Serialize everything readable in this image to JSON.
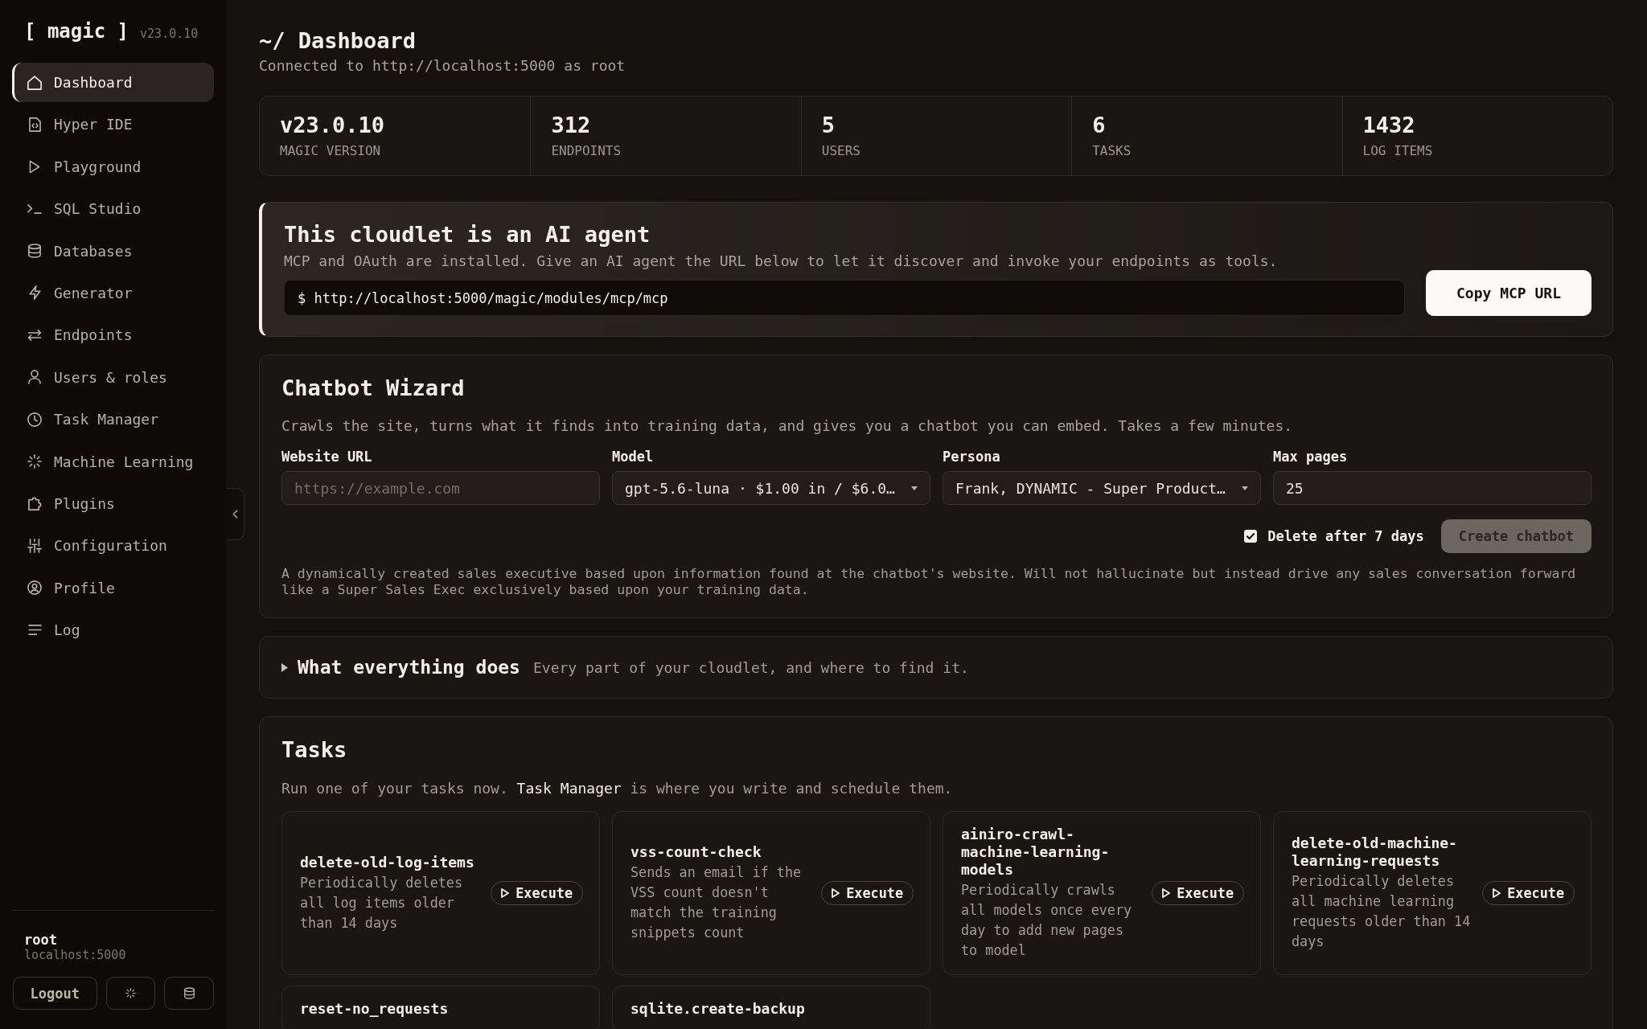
{
  "sidebar": {
    "logo": "[ magic ]",
    "version": "v23.0.10",
    "nav": [
      {
        "label": "Dashboard",
        "selected": true
      },
      {
        "label": "Hyper IDE",
        "selected": false
      },
      {
        "label": "Playground",
        "selected": false
      },
      {
        "label": "SQL Studio",
        "selected": false
      },
      {
        "label": "Databases",
        "selected": false
      },
      {
        "label": "Generator",
        "selected": false
      },
      {
        "label": "Endpoints",
        "selected": false
      },
      {
        "label": "Users & roles",
        "selected": false
      },
      {
        "label": "Task Manager",
        "selected": false
      },
      {
        "label": "Machine Learning",
        "selected": false
      },
      {
        "label": "Plugins",
        "selected": false
      },
      {
        "label": "Configuration",
        "selected": false
      },
      {
        "label": "Profile",
        "selected": false
      },
      {
        "label": "Log",
        "selected": false
      }
    ],
    "user": {
      "name": "root",
      "host": "localhost:5000"
    },
    "logout_button": "Logout"
  },
  "header": {
    "title": "~/ Dashboard",
    "subtitle": "Connected to http://localhost:5000 as root"
  },
  "stats": [
    {
      "value": "v23.0.10",
      "label": "MAGIC VERSION"
    },
    {
      "value": "312",
      "label": "ENDPOINTS"
    },
    {
      "value": "5",
      "label": "USERS"
    },
    {
      "value": "6",
      "label": "TASKS"
    },
    {
      "value": "1432",
      "label": "LOG ITEMS"
    }
  ],
  "agent_card": {
    "title": "This cloudlet is an AI agent",
    "description": "MCP and OAuth are installed. Give an AI agent the URL below to let it discover and invoke your endpoints as tools.",
    "command": "$ http://localhost:5000/magic/modules/mcp/mcp",
    "button": "Copy MCP URL"
  },
  "chatbot_wizard": {
    "title": "Chatbot Wizard",
    "description": "Crawls the site, turns what it finds into training data, and gives you a chatbot you can embed. Takes a few minutes.",
    "fields": [
      {
        "kind": "input",
        "label": "Website URL",
        "placeholder": "https://example.com"
      },
      {
        "kind": "select",
        "label": "Model",
        "value": "gpt-5.6-luna · $1.00 in / $6.0…"
      },
      {
        "kind": "select",
        "label": "Persona",
        "value": "Frank, DYNAMIC - Super Product…"
      },
      {
        "kind": "input",
        "label": "Max pages",
        "value": "25"
      }
    ],
    "delete_option": {
      "label": "Delete after 7 days",
      "checked": true
    },
    "create_button": {
      "label": "Create chatbot",
      "disabled": true
    },
    "persona_description": "A dynamically created sales executive based upon information found at the chatbot's website. Will not hallucinate but instead drive any sales conversation forward like a Super Sales Exec exclusively based upon your training data."
  },
  "help_section": {
    "title": "What everything does",
    "subtitle": "Every part of your cloudlet, and where to find it.",
    "expanded": false
  },
  "tasks": {
    "title": "Tasks",
    "description": {
      "text_before": "Run one of your tasks now.",
      "link": "Task Manager",
      "text_after": "is where you write and schedule them."
    },
    "items": [
      {
        "name": "delete-old-log-items",
        "description": "Periodically deletes all log items older than 14 days",
        "button": "Execute"
      },
      {
        "name": "vss-count-check",
        "description": "Sends an email if the VSS count doesn't match the training snippets count",
        "button": "Execute"
      },
      {
        "name": "ainiro-crawl-machine-learning-models",
        "description": "Periodically crawls all models once every day to add new pages to model",
        "button": "Execute"
      },
      {
        "name": "delete-old-machine-learning-requests",
        "description": "Periodically deletes all machine learning requests older than 14 days",
        "button": "Execute"
      },
      {
        "name": "reset-no_requests"
      },
      {
        "name": "sqlite.create-backup"
      }
    ]
  }
}
